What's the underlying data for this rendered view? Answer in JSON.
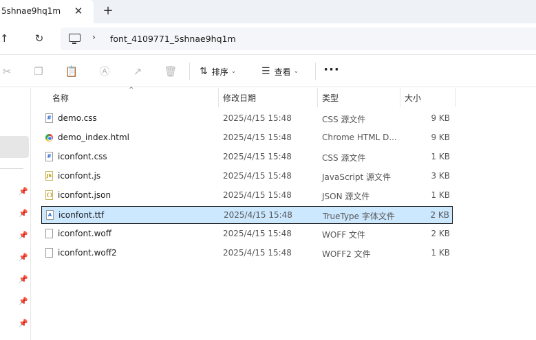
{
  "tab": {
    "title": "5shnae9hq1m",
    "close_glyph": "✕",
    "new_glyph": "+"
  },
  "address": {
    "separator": "›",
    "path": "font_4109771_5shnae9hq1m"
  },
  "toolbar": {
    "sort_label": "排序",
    "view_label": "查看",
    "more_glyph": "···",
    "dropdown_glyph": "⌄"
  },
  "columns": {
    "name": "名称",
    "date": "修改日期",
    "type": "类型",
    "size": "大小"
  },
  "files": [
    {
      "name": "demo.css",
      "date": "2025/4/15 15:48",
      "type": "CSS 源文件",
      "size": "9 KB",
      "icon": "css-file-icon",
      "badge": "#"
    },
    {
      "name": "demo_index.html",
      "date": "2025/4/15 15:48",
      "type": "Chrome HTML D...",
      "size": "9 KB",
      "icon": "chrome-html-icon",
      "badge": ""
    },
    {
      "name": "iconfont.css",
      "date": "2025/4/15 15:48",
      "type": "CSS 源文件",
      "size": "1 KB",
      "icon": "css-file-icon",
      "badge": "#"
    },
    {
      "name": "iconfont.js",
      "date": "2025/4/15 15:48",
      "type": "JavaScript 源文件",
      "size": "3 KB",
      "icon": "js-file-icon",
      "badge": "JS"
    },
    {
      "name": "iconfont.json",
      "date": "2025/4/15 15:48",
      "type": "JSON 源文件",
      "size": "1 KB",
      "icon": "json-file-icon",
      "badge": "{}"
    },
    {
      "name": "iconfont.ttf",
      "date": "2025/4/15 15:48",
      "type": "TrueType 字体文件",
      "size": "2 KB",
      "icon": "font-file-icon",
      "badge": "A",
      "selected": true
    },
    {
      "name": "iconfont.woff",
      "date": "2025/4/15 15:48",
      "type": "WOFF 文件",
      "size": "2 KB",
      "icon": "blank-file-icon",
      "badge": ""
    },
    {
      "name": "iconfont.woff2",
      "date": "2025/4/15 15:48",
      "type": "WOFF2 文件",
      "size": "1 KB",
      "icon": "blank-file-icon",
      "badge": ""
    }
  ],
  "colors": {
    "selection": "#cce8ff",
    "tabbar": "#eef1f6",
    "address_bg": "#f5f6f9"
  }
}
